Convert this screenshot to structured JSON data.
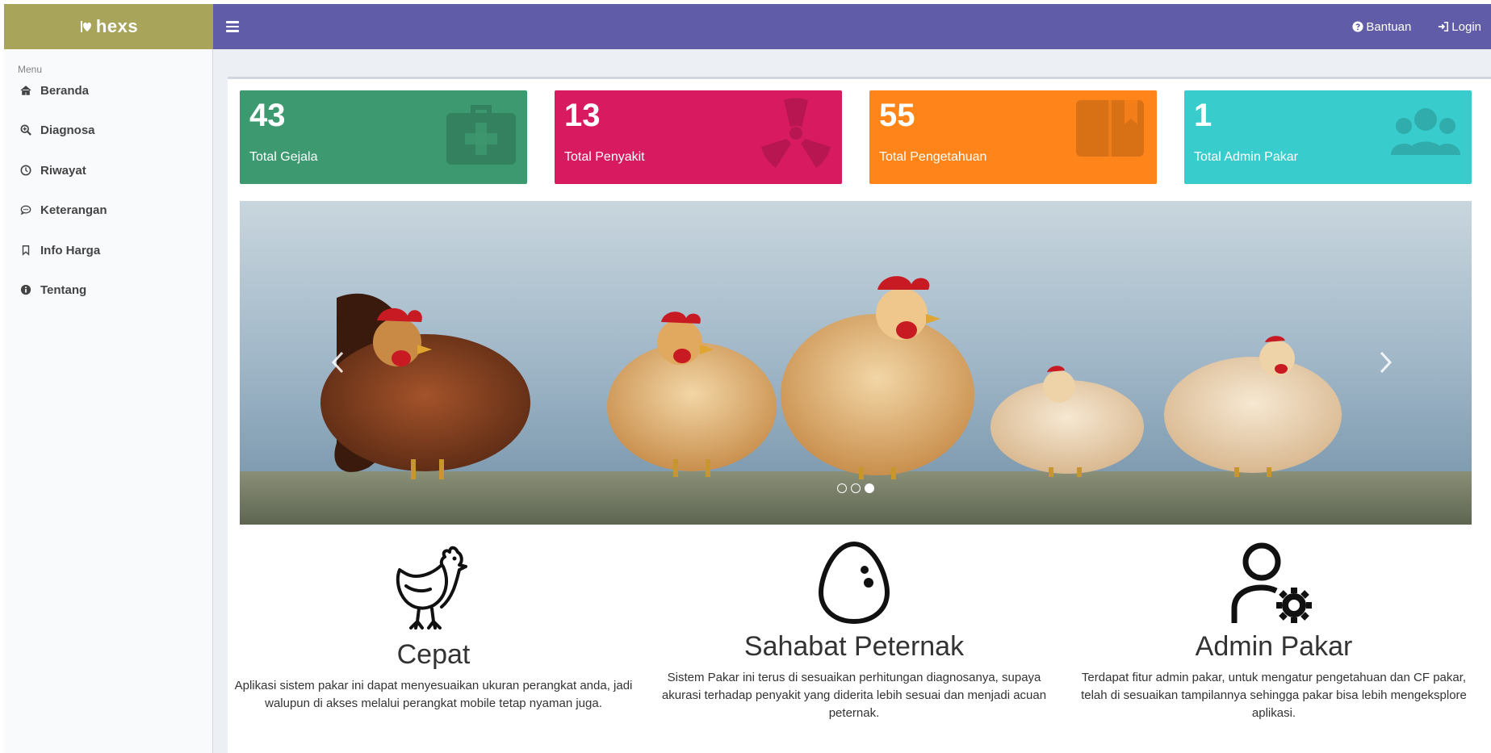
{
  "header": {
    "logo_text": "hexs",
    "help_label": "Bantuan",
    "login_label": "Login"
  },
  "sidebar": {
    "header": "Menu",
    "items": [
      {
        "label": "Beranda",
        "icon": "home-icon"
      },
      {
        "label": "Diagnosa",
        "icon": "search-plus-icon"
      },
      {
        "label": "Riwayat",
        "icon": "clock-icon"
      },
      {
        "label": "Keterangan",
        "icon": "comment-icon"
      },
      {
        "label": "Info Harga",
        "icon": "bookmark-icon"
      },
      {
        "label": "Tentang",
        "icon": "info-circle-icon"
      }
    ]
  },
  "stats": [
    {
      "value": "43",
      "label": "Total Gejala",
      "color": "#3d9970",
      "icon": "medkit-icon"
    },
    {
      "value": "13",
      "label": "Total Penyakit",
      "color": "#d81b60",
      "icon": "radiation-icon"
    },
    {
      "value": "55",
      "label": "Total Pengetahuan",
      "color": "#ff851b",
      "icon": "book-icon"
    },
    {
      "value": "1",
      "label": "Total Admin Pakar",
      "color": "#39cccc",
      "icon": "users-icon"
    }
  ],
  "carousel": {
    "slide_count": 3,
    "active_index": 2,
    "image": "chickens-photo"
  },
  "features": [
    {
      "title": "Cepat",
      "text": "Aplikasi sistem pakar ini dapat menyesuaikan ukuran perangkat anda, jadi walupun di akses melalui perangkat mobile tetap nyaman juga.",
      "icon": "chicken-icon"
    },
    {
      "title": "Sahabat Peternak",
      "text": "Sistem Pakar ini terus di sesuaikan perhitungan diagnosanya, supaya akurasi terhadap penyakit yang diderita lebih sesuai dan menjadi acuan peternak.",
      "icon": "egg-icon"
    },
    {
      "title": "Admin Pakar",
      "text": "Terdapat fitur admin pakar, untuk mengatur pengetahuan dan CF pakar, telah di sesuaikan tampilannya sehingga pakar bisa lebih mengeksplore aplikasi.",
      "icon": "user-gear-icon"
    }
  ]
}
